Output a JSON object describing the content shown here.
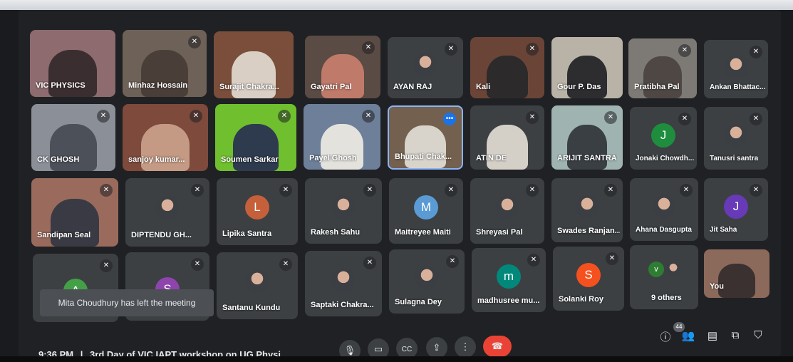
{
  "participants": {
    "vic_physics": "VIC PHYSICS",
    "minhaz": "Minhaz Hossain",
    "surajit": "Surajit Chakra...",
    "gayatri": "Gayatri Pal",
    "ayan": "AYAN RAJ",
    "kali": "Kali",
    "gour": "Gour P. Das",
    "pratibha": "Pratibha Pal",
    "ankan": "Ankan Bhattac...",
    "ck_ghosh": "CK GHOSH",
    "sanjoy": "sanjoy kumar...",
    "soumen": "Soumen Sarkar",
    "payel": "Payel Ghosh",
    "bhupati": "Bhupati Chak...",
    "atin": "ATIN DE",
    "arijit": "ARIJIT SANTRA",
    "jonaki": "Jonaki Chowdh...",
    "tanusri": "Tanusri santra",
    "sandipan": "Sandipan Seal",
    "diptendu": "DIPTENDU GH...",
    "lipika": "Lipika Santra",
    "rakesh": "Rakesh Sahu",
    "maitreyee": "Maitreyee Maiti",
    "shreyasi": "Shreyasi Pal",
    "swades": "Swades Ranjan...",
    "ahana": "Ahana Dasgupta",
    "jit": "Jit Saha",
    "santanu": "Santanu Kundu",
    "saptaki": "Saptaki Chakra...",
    "sulagna": "Sulagna Dey",
    "madhusree": "madhusree mu...",
    "solanki": "Solanki Roy",
    "others": "9 others",
    "you": "You"
  },
  "avatars": {
    "jonaki": "J",
    "lipika": "L",
    "maitreyee": "M",
    "jit": "J",
    "a_tile": "A",
    "s_tile": "S",
    "madhusree": "m",
    "solanki": "S",
    "others_v": "v"
  },
  "colors": {
    "jonaki": "#1e8e3e",
    "lipika": "#c5603a",
    "maitreyee": "#5b9bd5",
    "jit": "#673ab7",
    "a_tile": "#43a047",
    "s_tile": "#8e44ad",
    "madhusree": "#00897b",
    "solanki": "#f4511e",
    "others_v": "#2e7d32"
  },
  "notification": "Mita Choudhury has left the meeting",
  "bottom_bar": {
    "time": "9:36 PM",
    "separator": "|",
    "meeting_title": "3rd Day of VIC IAPT workshop on UG Physi...",
    "participant_count": "44"
  },
  "icons": {
    "mic_muted": "mic-off-icon",
    "more": "more-options-icon"
  }
}
